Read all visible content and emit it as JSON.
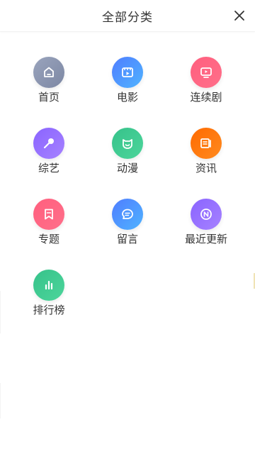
{
  "header": {
    "title": "全部分类",
    "close_icon": "close-icon"
  },
  "categories": [
    {
      "label": "首页",
      "icon": "home-icon",
      "color_start": "#9aa4bd",
      "color_end": "#7c87a3"
    },
    {
      "label": "电影",
      "icon": "film-icon",
      "color_start": "#4f7dff",
      "color_end": "#4fb3ff"
    },
    {
      "label": "连续剧",
      "icon": "tv-icon",
      "color_start": "#ff5f7e",
      "color_end": "#ff6f8a"
    },
    {
      "label": "综艺",
      "icon": "microphone-icon",
      "color_start": "#8a64ff",
      "color_end": "#a682ff"
    },
    {
      "label": "动漫",
      "icon": "cartoon-face-icon",
      "color_start": "#36c28a",
      "color_end": "#4cd59b"
    },
    {
      "label": "资讯",
      "icon": "news-icon",
      "color_start": "#ff6a00",
      "color_end": "#ff8a1f"
    },
    {
      "label": "专题",
      "icon": "bookmark-icon",
      "color_start": "#ff5f7e",
      "color_end": "#ff6f8a"
    },
    {
      "label": "留言",
      "icon": "message-icon",
      "color_start": "#4f7dff",
      "color_end": "#4fb3ff"
    },
    {
      "label": "最近更新",
      "icon": "new-icon",
      "color_start": "#8a64ff",
      "color_end": "#a682ff"
    },
    {
      "label": "排行榜",
      "icon": "ranking-icon",
      "color_start": "#36c28a",
      "color_end": "#4cd59b"
    }
  ]
}
